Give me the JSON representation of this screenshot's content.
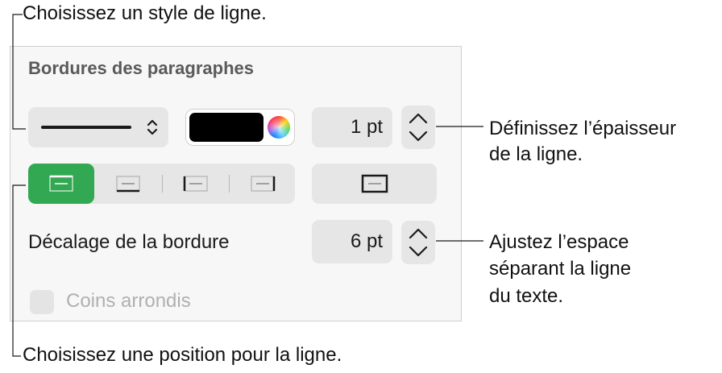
{
  "callouts": {
    "line_style": "Choisissez un style de ligne.",
    "thickness_line1": "Définissez l’épaisseur",
    "thickness_line2": "de la ligne.",
    "spacing_line1": "Ajustez l’espace",
    "spacing_line2": "séparant la ligne",
    "spacing_line3": "du texte.",
    "position": "Choisissez une position pour la ligne."
  },
  "panel": {
    "title": "Bordures des paragraphes",
    "line_style_value": "solid",
    "color": "#000000",
    "thickness_value": "1 pt",
    "position_buttons": [
      {
        "icon": "border-top-icon",
        "selected": true
      },
      {
        "icon": "border-bottom-icon",
        "selected": false
      },
      {
        "icon": "border-left-icon",
        "selected": false
      },
      {
        "icon": "border-right-icon",
        "selected": false
      }
    ],
    "box_border_icon": "border-box-icon",
    "offset_label": "Décalage de la bordure",
    "offset_value": "6 pt",
    "rounded_corners_label": "Coins arrondis",
    "rounded_corners_checked": false
  },
  "colors": {
    "accent_green": "#33a852",
    "control_bg": "#e6e6e6",
    "panel_bg": "#f7f7f7"
  }
}
